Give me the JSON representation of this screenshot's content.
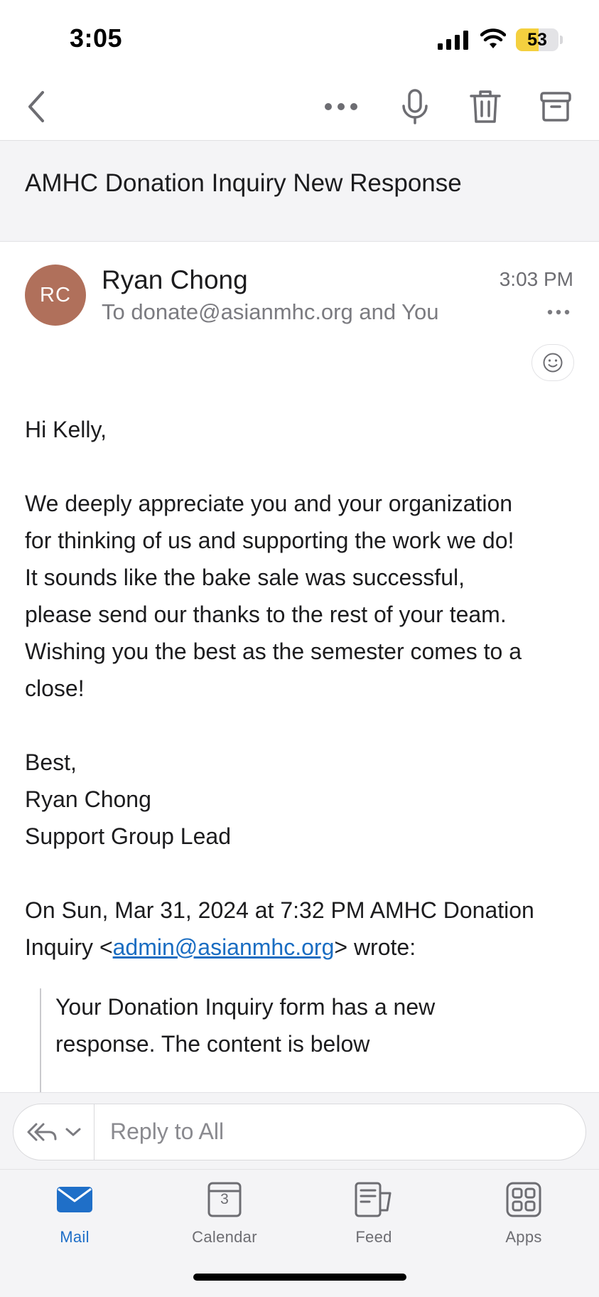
{
  "status_bar": {
    "time": "3:05",
    "battery_level": "53",
    "battery_fraction": 0.53,
    "icons": [
      "signal-icon",
      "wifi-icon",
      "battery-icon"
    ]
  },
  "toolbar": {
    "icons": [
      "back-icon",
      "more-icon",
      "microphone-icon",
      "trash-icon",
      "archive-icon"
    ]
  },
  "email": {
    "subject": "AMHC Donation Inquiry New Response",
    "avatar_initials": "RC",
    "avatar_color": "#b0705b",
    "sender": "Ryan Chong",
    "recipients": "To donate@asianmhc.org and You",
    "time": "3:03 PM",
    "greeting": "Hi Kelly,",
    "body_lines": [
      "We deeply appreciate you and your organization",
      "for thinking of us and supporting the work we do!",
      "It sounds like the bake sale was successful,",
      "please send our thanks to the rest of your team.",
      "Wishing you the best as the semester comes to a",
      "close!"
    ],
    "signoff": "Best,",
    "signature_name": "Ryan Chong",
    "signature_title": "Support Group Lead",
    "quote_header_1": "On Sun, Mar 31, 2024 at 7:32 PM AMHC Donation",
    "quote_header_2_prefix": "Inquiry <",
    "quote_header_link": "admin@asianmhc.org",
    "quote_header_2_suffix": "> wrote:",
    "quoted_lines": [
      "Your Donation Inquiry form has a new",
      "response. The content is below"
    ]
  },
  "reply": {
    "placeholder": "Reply to All"
  },
  "tabs": [
    {
      "label": "Mail",
      "icon": "mail-icon",
      "active": true
    },
    {
      "label": "Calendar",
      "icon": "calendar-icon",
      "active": false,
      "badge": "3"
    },
    {
      "label": "Feed",
      "icon": "feed-icon",
      "active": false
    },
    {
      "label": "Apps",
      "icon": "apps-icon",
      "active": false
    }
  ],
  "colors": {
    "accent": "#1f6fc8",
    "link": "#1a6dc2",
    "battery": "#f4d03f"
  }
}
